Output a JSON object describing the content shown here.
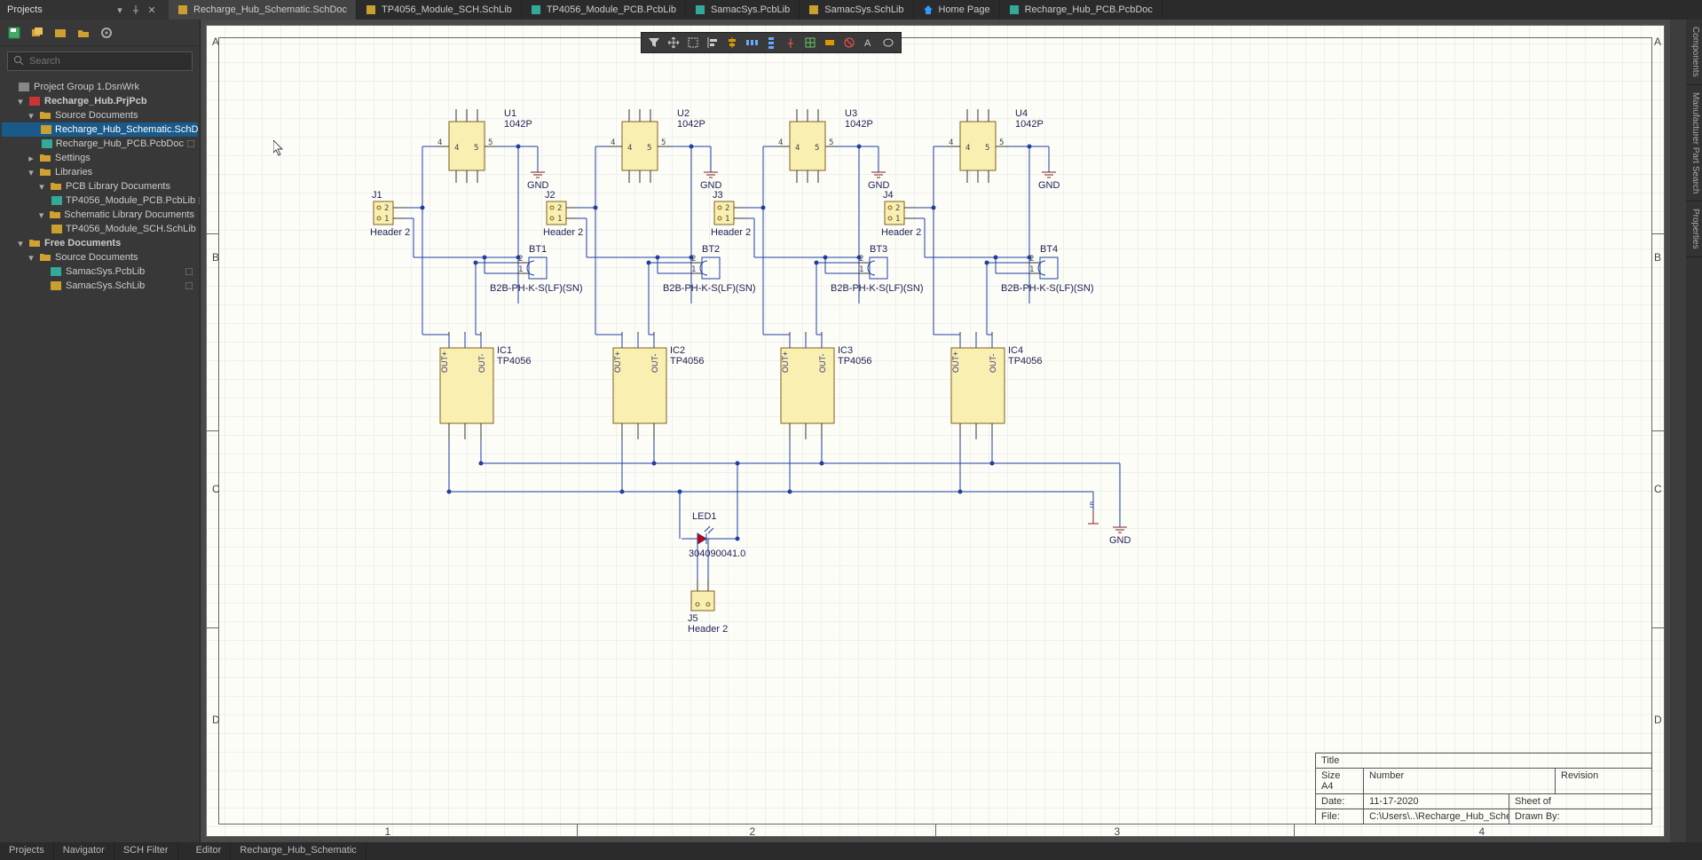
{
  "panel": {
    "title": "Projects"
  },
  "tabs": [
    {
      "icon": "sch",
      "label": "Recharge_Hub_Schematic.SchDoc",
      "active": true
    },
    {
      "icon": "schlib",
      "label": "TP4056_Module_SCH.SchLib"
    },
    {
      "icon": "pcblib",
      "label": "TP4056_Module_PCB.PcbLib"
    },
    {
      "icon": "pcblib",
      "label": "SamacSys.PcbLib"
    },
    {
      "icon": "schlib",
      "label": "SamacSys.SchLib"
    },
    {
      "icon": "home",
      "label": "Home Page"
    },
    {
      "icon": "pcb",
      "label": "Recharge_Hub_PCB.PcbDoc"
    }
  ],
  "rails": {
    "r1": [
      "Components",
      "Manufacturer Part Search",
      "Properties"
    ]
  },
  "search": {
    "placeholder": "Search"
  },
  "tree": [
    {
      "lvl": 0,
      "tw": "",
      "ico": "grp",
      "label": "Project Group 1.DsnWrk"
    },
    {
      "lvl": 1,
      "tw": "▾",
      "ico": "prj",
      "label": "Recharge_Hub.PrjPcb",
      "bold": true
    },
    {
      "lvl": 2,
      "tw": "▾",
      "ico": "fld",
      "label": "Source Documents"
    },
    {
      "lvl": 3,
      "tw": "",
      "ico": "sch",
      "label": "Recharge_Hub_Schematic.SchD",
      "sel": true,
      "flag": true
    },
    {
      "lvl": 3,
      "tw": "",
      "ico": "pcb",
      "label": "Recharge_Hub_PCB.PcbDoc",
      "flag": true
    },
    {
      "lvl": 2,
      "tw": "▸",
      "ico": "fld",
      "label": "Settings"
    },
    {
      "lvl": 2,
      "tw": "▾",
      "ico": "fld",
      "label": "Libraries"
    },
    {
      "lvl": 3,
      "tw": "▾",
      "ico": "fld",
      "label": "PCB Library Documents"
    },
    {
      "lvl": 4,
      "tw": "",
      "ico": "pcblib",
      "label": "TP4056_Module_PCB.PcbLib",
      "flag": true
    },
    {
      "lvl": 3,
      "tw": "▾",
      "ico": "fld",
      "label": "Schematic Library Documents"
    },
    {
      "lvl": 4,
      "tw": "",
      "ico": "schlib",
      "label": "TP4056_Module_SCH.SchLib",
      "flag": true
    },
    {
      "lvl": 1,
      "tw": "▾",
      "ico": "fld",
      "label": "Free Documents",
      "bold": true
    },
    {
      "lvl": 2,
      "tw": "▾",
      "ico": "fld",
      "label": "Source Documents"
    },
    {
      "lvl": 3,
      "tw": "",
      "ico": "pcblib",
      "label": "SamacSys.PcbLib",
      "flag": true
    },
    {
      "lvl": 3,
      "tw": "",
      "ico": "schlib",
      "label": "SamacSys.SchLib",
      "flag": true
    }
  ],
  "status": {
    "left": [
      "Projects",
      "Navigator",
      "SCH Filter"
    ],
    "mid": [
      "Editor",
      "Recharge_Hub_Schematic"
    ]
  },
  "zones": {
    "rows": [
      "A",
      "B",
      "C",
      "D"
    ],
    "cols": [
      "1",
      "2",
      "3",
      "4"
    ]
  },
  "titleblock": {
    "title_lbl": "Title",
    "size_lbl": "Size",
    "size_val": "A4",
    "number_lbl": "Number",
    "revision_lbl": "Revision",
    "date_lbl": "Date:",
    "date_val": "11-17-2020",
    "sheet_lbl": "Sheet   of",
    "file_lbl": "File:",
    "file_val": "C:\\Users\\..\\Recharge_Hub_Schematic.Sch",
    "drawn_lbl": "Drawn By:"
  },
  "components": {
    "u": [
      {
        "d": "U1",
        "v": "1042P"
      },
      {
        "d": "U2",
        "v": "1042P"
      },
      {
        "d": "U3",
        "v": "1042P"
      },
      {
        "d": "U4",
        "v": "1042P"
      }
    ],
    "j": [
      {
        "d": "J1",
        "v": "Header 2"
      },
      {
        "d": "J2",
        "v": "Header 2"
      },
      {
        "d": "J3",
        "v": "Header 2"
      },
      {
        "d": "J4",
        "v": "Header 2"
      }
    ],
    "bt": [
      {
        "d": "BT1",
        "v": "B2B-PH-K-S(LF)(SN)"
      },
      {
        "d": "BT2",
        "v": "B2B-PH-K-S(LF)(SN)"
      },
      {
        "d": "BT3",
        "v": "B2B-PH-K-S(LF)(SN)"
      },
      {
        "d": "BT4",
        "v": "B2B-PH-K-S(LF)(SN)"
      }
    ],
    "ic": [
      {
        "d": "IC1",
        "v": "TP4056"
      },
      {
        "d": "IC2",
        "v": "TP4056"
      },
      {
        "d": "IC3",
        "v": "TP4056"
      },
      {
        "d": "IC4",
        "v": "TP4056"
      }
    ],
    "j5": {
      "d": "J5",
      "v": "Header 2"
    },
    "led": {
      "d": "LED1",
      "v": "304090041.0"
    },
    "gnd_label": "GND",
    "pin4": "4",
    "pin5": "5",
    "pin1": "1",
    "pin2": "2"
  }
}
